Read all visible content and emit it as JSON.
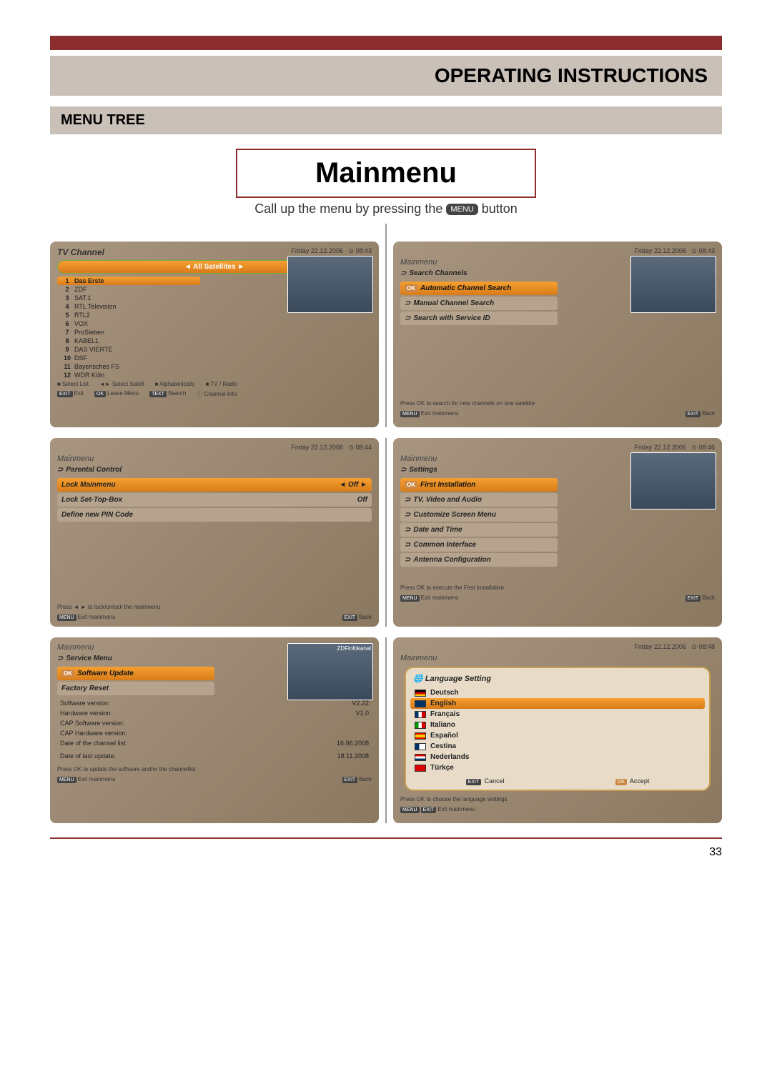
{
  "header": {
    "title": "OPERATING INSTRUCTIONS",
    "section": "MENU TREE"
  },
  "main": {
    "title": "Mainmenu",
    "instruction_pre": "Call up the menu by pressing the ",
    "instruction_btn": "MENU",
    "instruction_post": " button"
  },
  "screen1": {
    "title": "TV Channel",
    "date": "Friday 22.12.2006",
    "time": "08:43",
    "sat": "All Satellites",
    "channels": [
      {
        "n": "1",
        "name": "Das Erste"
      },
      {
        "n": "2",
        "name": "ZDF"
      },
      {
        "n": "3",
        "name": "SAT.1"
      },
      {
        "n": "4",
        "name": "RTL Television"
      },
      {
        "n": "5",
        "name": "RTL2"
      },
      {
        "n": "6",
        "name": "VOX"
      },
      {
        "n": "7",
        "name": "ProSieben"
      },
      {
        "n": "8",
        "name": "KABEL1"
      },
      {
        "n": "9",
        "name": "DAS VIERTE"
      },
      {
        "n": "10",
        "name": "DSF"
      },
      {
        "n": "11",
        "name": "Bayerisches FS"
      },
      {
        "n": "12",
        "name": "WDR Köln"
      }
    ],
    "foot": {
      "a": "Select List",
      "b": "Select Satell",
      "c": "Alphabetically",
      "d": "TV / Radio",
      "e": "Exit",
      "f": "Leave Menu",
      "g": "Search",
      "h": "Channel-Info"
    }
  },
  "screen2": {
    "bc": "Mainmenu",
    "sub": "Search Channels",
    "date": "Friday 22.12.2006",
    "time": "08:43",
    "items": [
      "Automatic Channel Search",
      "Manual Channel Search",
      "Search with Service ID"
    ],
    "hint": "Press OK to search for new channels on one satellite",
    "foot": {
      "a": "Exit mainmenu",
      "b": "Back"
    }
  },
  "screen3": {
    "bc": "Mainmenu",
    "sub": "Parental Control",
    "date": "Friday 22.12.2006",
    "time": "08:44",
    "rows": [
      {
        "l": "Lock Mainmenu",
        "v": "Off"
      },
      {
        "l": "Lock Set-Top-Box",
        "v": "Off"
      },
      {
        "l": "Define new PIN Code",
        "v": ""
      }
    ],
    "hint": "Press ◄ ► to lock/unlock the mainmenu",
    "foot": {
      "a": "Exit mainmenu",
      "b": "Back"
    }
  },
  "screen4": {
    "bc": "Mainmenu",
    "sub": "Settings",
    "date": "Friday 22.12.2006",
    "time": "08:46",
    "items": [
      "First Installation",
      "TV, Video and Audio",
      "Customize Screen Menu",
      "Date and Time",
      "Common Interface",
      "Antenna Configuration"
    ],
    "hint": "Press OK to execute the First Installation",
    "foot": {
      "a": "Exit mainmenu",
      "b": "Back"
    }
  },
  "screen5": {
    "bc": "Mainmenu",
    "sub": "Service Menu",
    "pip": "ZDFinfokanal",
    "items": [
      "Software Update",
      "Factory Reset"
    ],
    "info": [
      {
        "l": "Software version:",
        "v": "V2.22"
      },
      {
        "l": "Hardware version:",
        "v": "V1.0"
      },
      {
        "l": "CAP Software version:",
        "v": ""
      },
      {
        "l": "CAP Hardware version:",
        "v": ""
      },
      {
        "l": "Date of the channel list:",
        "v": "16.06.2008"
      },
      {
        "l": "",
        "v": ""
      },
      {
        "l": "Date of last update:",
        "v": "18.11.2008"
      }
    ],
    "hint": "Press OK to update the software and/or the channellist",
    "foot": {
      "a": "Exit mainmenu",
      "b": "Back"
    }
  },
  "screen6": {
    "bc": "Mainmenu",
    "date": "Friday 22.12.2006",
    "time": "08:48",
    "popup_title": "Language Setting",
    "langs": [
      "Deutsch",
      "English",
      "Français",
      "Italiano",
      "Español",
      "Cestina",
      "Nederlands",
      "Türkçe"
    ],
    "popup_foot": {
      "a": "Cancel",
      "b": "Accept"
    },
    "hint": "Press OK to choose the language settings",
    "foot": {
      "a": "Exit mainmenu"
    }
  },
  "page_number": "33"
}
